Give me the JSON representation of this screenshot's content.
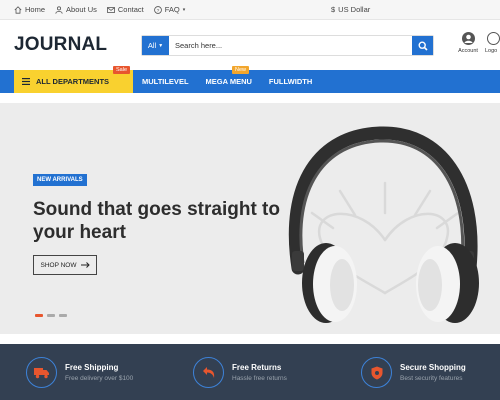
{
  "topbar": {
    "links": [
      {
        "label": "Home",
        "icon": "home-icon"
      },
      {
        "label": "About Us",
        "icon": "about-icon"
      },
      {
        "label": "Contact",
        "icon": "mail-icon"
      },
      {
        "label": "FAQ",
        "icon": "help-icon"
      }
    ],
    "currency": {
      "symbol": "$",
      "label": "US Dollar"
    }
  },
  "header": {
    "logo": "JOURNAL",
    "search": {
      "category": "All",
      "placeholder": "Search here...",
      "button_icon": "search-icon"
    },
    "account_label": "Account",
    "logout_label": "Logo"
  },
  "nav": {
    "departments": "ALL DEPARTMENTS",
    "links": [
      "MULTILEVEL",
      "MEGA MENU",
      "FULLWIDTH"
    ],
    "badges": {
      "sale": "Sale",
      "new": "New"
    }
  },
  "hero": {
    "tag": "NEW ARRIVALS",
    "title": "Sound that goes straight to your heart",
    "button": "SHOP NOW",
    "slides": 3,
    "active_slide": 1
  },
  "features": [
    {
      "title": "Free Shipping",
      "subtitle": "Free delivery over $100",
      "icon": "truck-icon"
    },
    {
      "title": "Free Returns",
      "subtitle": "Hassle free returns",
      "icon": "return-icon"
    },
    {
      "title": "Secure Shopping",
      "subtitle": "Best security features",
      "icon": "shield-icon"
    }
  ],
  "colors": {
    "primary": "#2271d1",
    "accent": "#f9d12f",
    "sale": "#e8562e",
    "new_badge": "#f2a62d",
    "footer_bg": "#334052"
  }
}
